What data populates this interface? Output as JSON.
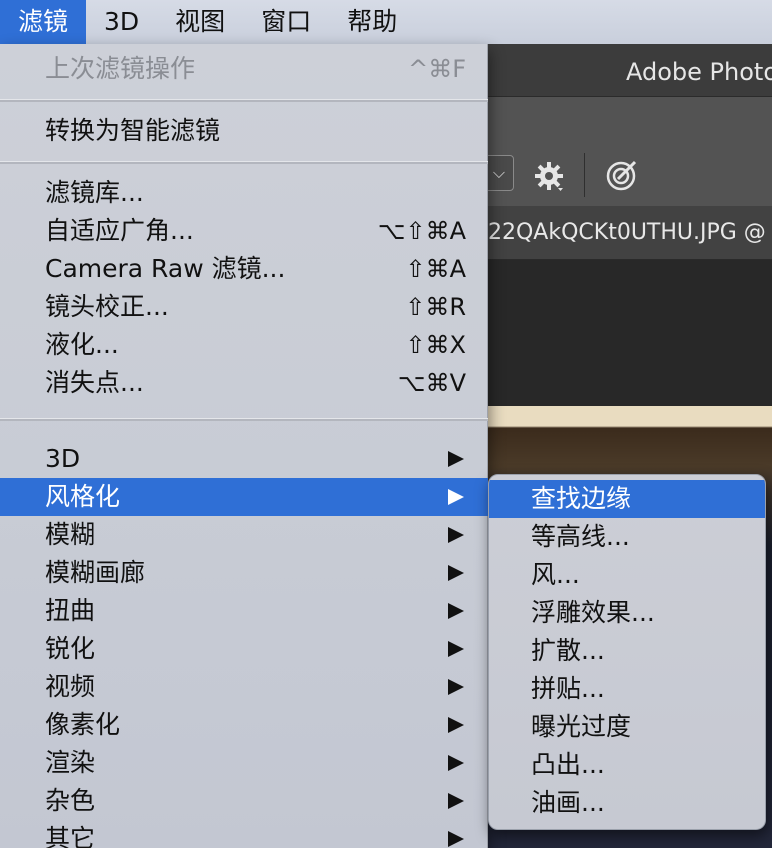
{
  "menubar": {
    "items": [
      {
        "label": "滤镜"
      },
      {
        "label": "3D"
      },
      {
        "label": "视图"
      },
      {
        "label": "窗口"
      },
      {
        "label": "帮助"
      }
    ]
  },
  "app": {
    "title": "Adobe Photo",
    "document_tab": "22QAkQCKt0UTHU.JPG @",
    "dropdown_glyph": "⌵"
  },
  "filter_menu": {
    "last_filter": {
      "label": "上次滤镜操作",
      "shortcut": "^⌘F"
    },
    "convert_smart": {
      "label": "转换为智能滤镜"
    },
    "filter_gallery": {
      "label": "滤镜库..."
    },
    "adaptive_wide_angle": {
      "label": "自适应广角...",
      "shortcut": "⌥⇧⌘A"
    },
    "camera_raw": {
      "label": "Camera Raw 滤镜...",
      "shortcut": "⇧⌘A"
    },
    "lens_correction": {
      "label": "镜头校正...",
      "shortcut": "⇧⌘R"
    },
    "liquify": {
      "label": "液化...",
      "shortcut": "⇧⌘X"
    },
    "vanishing_point": {
      "label": "消失点...",
      "shortcut": "⌥⌘V"
    },
    "submenus": [
      {
        "label": "3D"
      },
      {
        "label": "风格化"
      },
      {
        "label": "模糊"
      },
      {
        "label": "模糊画廊"
      },
      {
        "label": "扭曲"
      },
      {
        "label": "锐化"
      },
      {
        "label": "视频"
      },
      {
        "label": "像素化"
      },
      {
        "label": "渲染"
      },
      {
        "label": "杂色"
      },
      {
        "label": "其它"
      }
    ]
  },
  "stylize_submenu": {
    "items": [
      {
        "label": "查找边缘"
      },
      {
        "label": "等高线..."
      },
      {
        "label": "风..."
      },
      {
        "label": "浮雕效果..."
      },
      {
        "label": "扩散..."
      },
      {
        "label": "拼贴..."
      },
      {
        "label": "曝光过度"
      },
      {
        "label": "凸出..."
      },
      {
        "label": "油画..."
      }
    ]
  },
  "colors": {
    "highlight": "#2f6fd6",
    "menu_bg": "#cdd0d8",
    "ps_dark": "#3c3c3c"
  }
}
